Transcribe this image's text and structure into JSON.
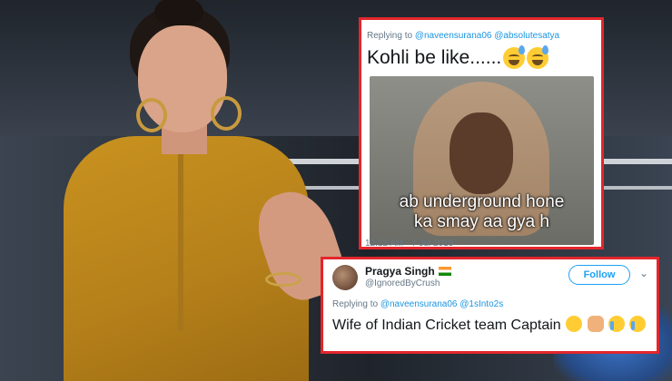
{
  "tweet1": {
    "replying_prefix": "Replying to",
    "reply_handles": "@naveensurana06 @absolutesatya",
    "text": "Kohli be like......",
    "meme_caption_line1": "ab underground hone",
    "meme_caption_line2": "ka smay aa gya h",
    "timestamp": "12:12 AM - 7 Jul 2019"
  },
  "tweet2": {
    "display_name": "Pragya Singh",
    "username": "@IgnoredByCrush",
    "follow_label": "Follow",
    "chevron": "⌄",
    "replying_prefix": "Replying to",
    "reply_handles": "@naveensurana06 @1sInto2s",
    "text": "Wife of Indian Cricket team Captain"
  },
  "icons": {
    "tweet1_emojis": [
      "sweat-smile-emoji",
      "sweat-smile-emoji"
    ],
    "tweet2_emojis": [
      "neutral-face-emoji",
      "folded-hands-emoji",
      "crying-face-emoji",
      "crying-face-emoji"
    ],
    "flag": "india-flag-icon"
  },
  "colors": {
    "card_border": "#e3262c",
    "link": "#1b95e0",
    "follow": "#1da1f2"
  }
}
